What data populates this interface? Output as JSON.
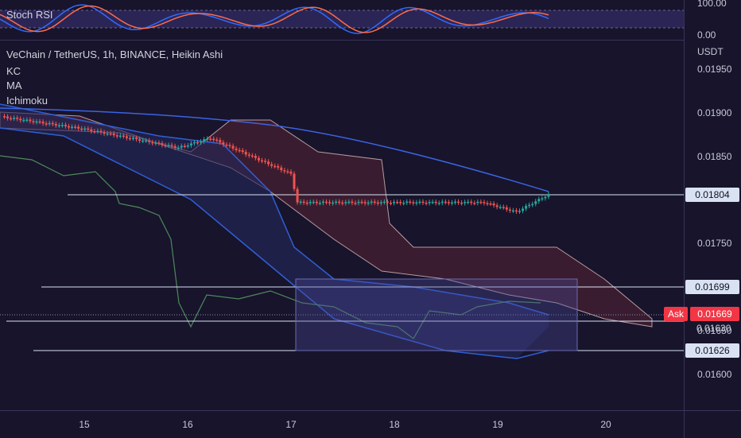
{
  "rsi": {
    "label": "Stoch RSI",
    "scale_top": "100.00",
    "scale_bottom": "0.00"
  },
  "chart": {
    "title": "VeChain / TetherUS, 1h, BINANCE, Heikin Ashi",
    "indicators": [
      "KC",
      "MA",
      "Ichimoku"
    ],
    "currency": "USDT"
  },
  "price_axis": {
    "ticks": [
      "0.01950",
      "0.01900",
      "0.01850",
      "0.01750",
      "0.01650",
      "0.01600"
    ],
    "tagged_levels": [
      {
        "label": "0.01804",
        "value": 0.01804
      },
      {
        "label": "0.01699",
        "value": 0.01699
      },
      {
        "label": "0.01626",
        "value": 0.01626
      }
    ],
    "ask": {
      "word": "Ask",
      "label": "0.01669",
      "value": 0.01669
    },
    "partial_label": "0.01630"
  },
  "time_axis": {
    "ticks": [
      "15",
      "16",
      "17",
      "18",
      "19",
      "20"
    ]
  },
  "colors": {
    "background": "#17142c",
    "up": "#26a69a",
    "down": "#ef5350",
    "kc": "#2f5fd6",
    "ma": "#3c63e0",
    "cloud_red": "#7a2a3a",
    "rsi_k": "#2f6bff",
    "rsi_d": "#ff6b4a",
    "range_box": "#4a4a9a"
  }
}
